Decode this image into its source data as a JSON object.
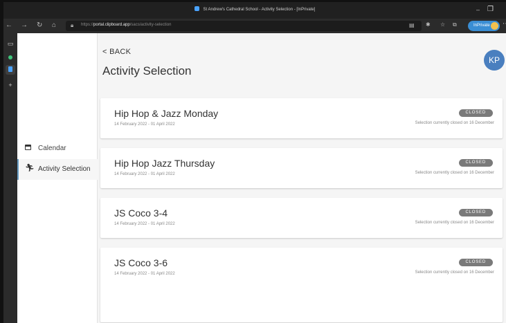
{
  "browser": {
    "window_title": "St Andrew's Cathedral School - Activity Selection - [InPrivate]",
    "url_prefix": "https://",
    "url_host": "portal.clipboard.app",
    "url_path": "/sacs/activity-selection",
    "inprivate_label": "InPrivate",
    "minimize_glyph": "–",
    "maximize_glyph": "❐",
    "more_glyph": "⋯",
    "nav": {
      "back": "←",
      "forward": "→",
      "refresh": "↻",
      "home": "⌂"
    },
    "tabstrip": {
      "new_tab": "+"
    },
    "colors": {
      "titlebar": "#202020",
      "toolbar": "#2b2b2b",
      "accent": "#3a8ed4"
    }
  },
  "sidebar": {
    "items": [
      {
        "label": "Calendar",
        "icon": "calendar-icon"
      },
      {
        "label": "Activity Selection",
        "icon": "running-person-icon"
      }
    ]
  },
  "page": {
    "back_label": "< BACK",
    "title": "Activity Selection",
    "avatar_initials": "KP"
  },
  "activities": [
    {
      "name": "Hip Hop & Jazz Monday",
      "dates": "14 February 2022 - 01 April 2022",
      "status": "CLOSED",
      "note": "Selection currently closed on 16 December"
    },
    {
      "name": "Hip Hop Jazz Thursday",
      "dates": "14 February 2022 - 01 April 2022",
      "status": "CLOSED",
      "note": "Selection currently closed on 16 December"
    },
    {
      "name": "JS Coco 3-4",
      "dates": "14 February 2022 - 01 April 2022",
      "status": "CLOSED",
      "note": "Selection currently closed on 16 December"
    },
    {
      "name": "JS Coco 3-6",
      "dates": "14 February 2022 - 01 April 2022",
      "status": "CLOSED",
      "note": "Selection currently closed on 16 December"
    }
  ],
  "colors": {
    "avatar": "#4a7fbf",
    "badge": "#7a7a7a",
    "active_indicator": "#6aa0c8",
    "background": "#f5f5f5"
  }
}
